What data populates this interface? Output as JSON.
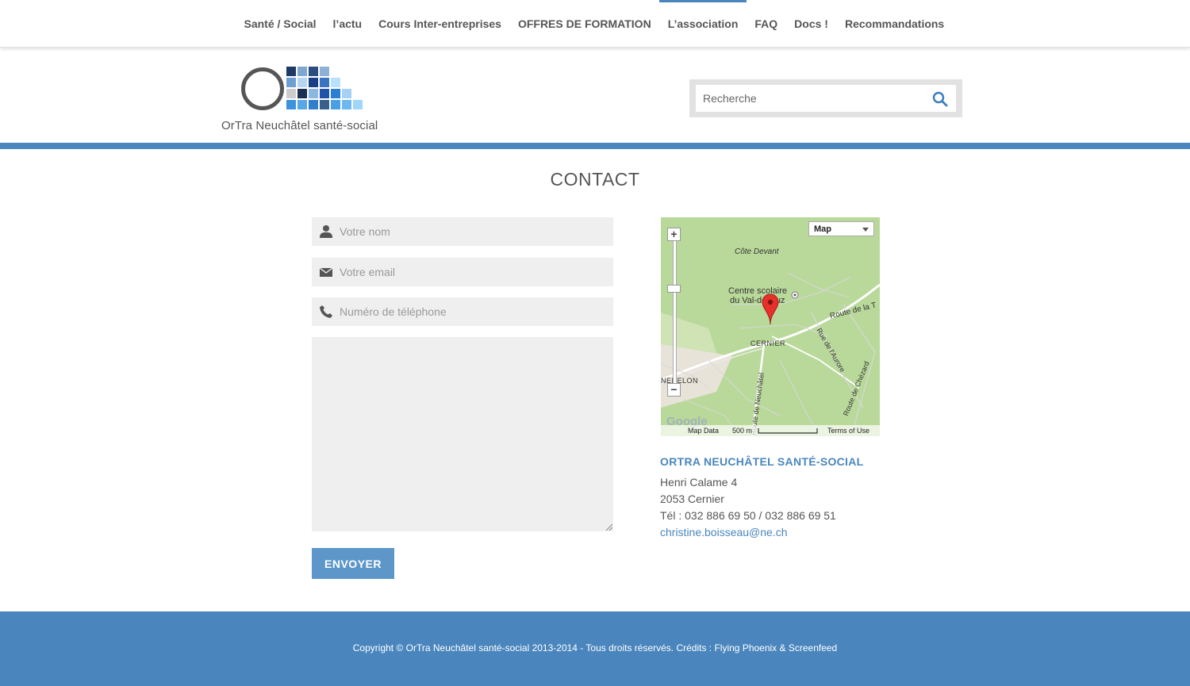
{
  "nav": {
    "items": [
      {
        "label": "Santé / Social"
      },
      {
        "label": "l’actu"
      },
      {
        "label": "Cours Inter-entreprises"
      },
      {
        "label": "OFFRES DE FORMATION"
      },
      {
        "label": "L’association",
        "active": true
      },
      {
        "label": "FAQ"
      },
      {
        "label": "Docs !"
      },
      {
        "label": "Recommandations"
      }
    ]
  },
  "header": {
    "logo_text": "OrTra Neuchâtel santé-social",
    "search_placeholder": "Recherche"
  },
  "page": {
    "title": "CONTACT"
  },
  "form": {
    "name_placeholder": "Votre nom",
    "email_placeholder": "Votre email",
    "phone_placeholder": "Numéro de téléphone",
    "message_value": "",
    "send_label": "ENVOYER"
  },
  "map": {
    "type_label": "Map",
    "zoom_in": "+",
    "zoom_out": "−",
    "labels": {
      "cote_devant": "Côte Devant",
      "centre_1": "Centre scolaire",
      "centre_2": "du Val-de-Ruz",
      "cernier": "CERNIER",
      "route_t": "Route de la T",
      "aurore": "Rue de l'Aurore",
      "chezard": "Route de Chézard",
      "neuchatel": "Route de Neuchâtel",
      "fenelon": "NENELON"
    },
    "google": "Google",
    "map_data": "Map Data",
    "scale": "500 m",
    "terms": "Terms of Use"
  },
  "address": {
    "org_name": "ORTRA NEUCHÂTEL SANTÉ-SOCIAL",
    "street": "Henri Calame 4",
    "city": "2053 Cernier",
    "phone": "Tél : 032 886 69 50 / 032 886 69 51",
    "email": "christine.boisseau@ne.ch"
  },
  "footer": {
    "text": "Copyright © OrTra Neuchâtel santé-social 2013-2014 - Tous droits réservés. Crédits : Flying Phoenix & Screenfeed"
  },
  "colors": {
    "accent": "#4a86bd",
    "button": "#5d97c9",
    "field_bg": "#efefef",
    "map_bg": "#b9d99a",
    "text": "#555555"
  }
}
